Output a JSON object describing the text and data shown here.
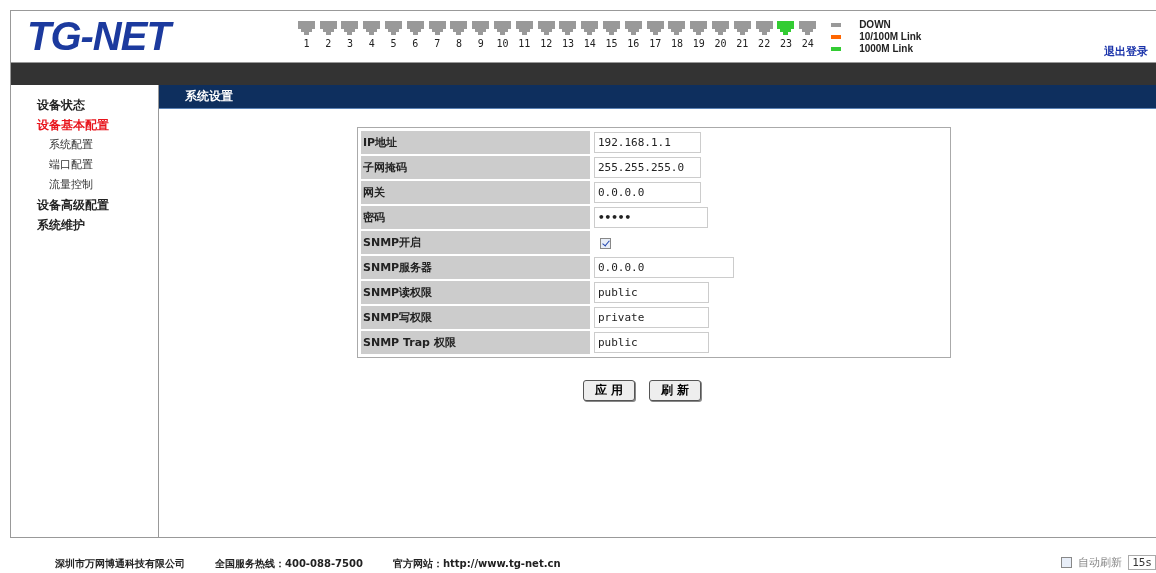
{
  "logo": "TG-NET",
  "ports": [
    {
      "label": "1",
      "color": "#999999"
    },
    {
      "label": "2",
      "color": "#999999"
    },
    {
      "label": "3",
      "color": "#999999"
    },
    {
      "label": "4",
      "color": "#999999"
    },
    {
      "label": "5",
      "color": "#999999"
    },
    {
      "label": "6",
      "color": "#999999"
    },
    {
      "label": "7",
      "color": "#999999"
    },
    {
      "label": "8",
      "color": "#999999"
    },
    {
      "label": "9",
      "color": "#999999"
    },
    {
      "label": "10",
      "color": "#999999"
    },
    {
      "label": "11",
      "color": "#999999"
    },
    {
      "label": "12",
      "color": "#999999"
    },
    {
      "label": "13",
      "color": "#999999"
    },
    {
      "label": "14",
      "color": "#999999"
    },
    {
      "label": "15",
      "color": "#999999"
    },
    {
      "label": "16",
      "color": "#999999"
    },
    {
      "label": "17",
      "color": "#999999"
    },
    {
      "label": "18",
      "color": "#999999"
    },
    {
      "label": "19",
      "color": "#999999"
    },
    {
      "label": "20",
      "color": "#999999"
    },
    {
      "label": "21",
      "color": "#999999"
    },
    {
      "label": "22",
      "color": "#999999"
    },
    {
      "label": "23",
      "color": "#33cc33"
    },
    {
      "label": "24",
      "color": "#999999"
    }
  ],
  "legend": [
    {
      "label": "DOWN",
      "color": "#999999"
    },
    {
      "label": "10/100M Link",
      "color": "#ff6600"
    },
    {
      "label": "1000M Link",
      "color": "#33cc33"
    }
  ],
  "logout": "退出登录",
  "sidebar": {
    "items": [
      {
        "label": "设备状态",
        "selected": false
      },
      {
        "label": "设备基本配置",
        "selected": true,
        "children": [
          {
            "label": "系统配置"
          },
          {
            "label": "端口配置"
          },
          {
            "label": "流量控制"
          }
        ]
      },
      {
        "label": "设备高级配置",
        "selected": false
      },
      {
        "label": "系统维护",
        "selected": false
      }
    ]
  },
  "section_title": "系统设置",
  "form": {
    "rows": [
      {
        "label": "IP地址",
        "kind": "text",
        "value": "192.168.1.1"
      },
      {
        "label": "子网掩码",
        "kind": "text",
        "value": "255.255.255.0"
      },
      {
        "label": "网关",
        "kind": "text",
        "value": "0.0.0.0"
      },
      {
        "label": "密码",
        "kind": "password",
        "value": "•••••"
      },
      {
        "label": "SNMP开启",
        "kind": "checkbox",
        "checked": true
      },
      {
        "label": "SNMP服务器",
        "kind": "text",
        "value": "0.0.0.0"
      },
      {
        "label": "SNMP读权限",
        "kind": "text",
        "value": "public"
      },
      {
        "label": "SNMP写权限",
        "kind": "text",
        "value": "private"
      },
      {
        "label": "SNMP Trap 权限",
        "kind": "text",
        "value": "public"
      }
    ],
    "buttons": [
      "应 用",
      "刷 新"
    ]
  },
  "footer": {
    "company": "深圳市万网博通科技有限公司",
    "hotline": "全国服务热线：400-088-7500",
    "website": "官方网站：http://www.tg-net.cn",
    "auto_refresh": {
      "label": "自动刷新",
      "checked": false
    },
    "interval": "15s"
  }
}
